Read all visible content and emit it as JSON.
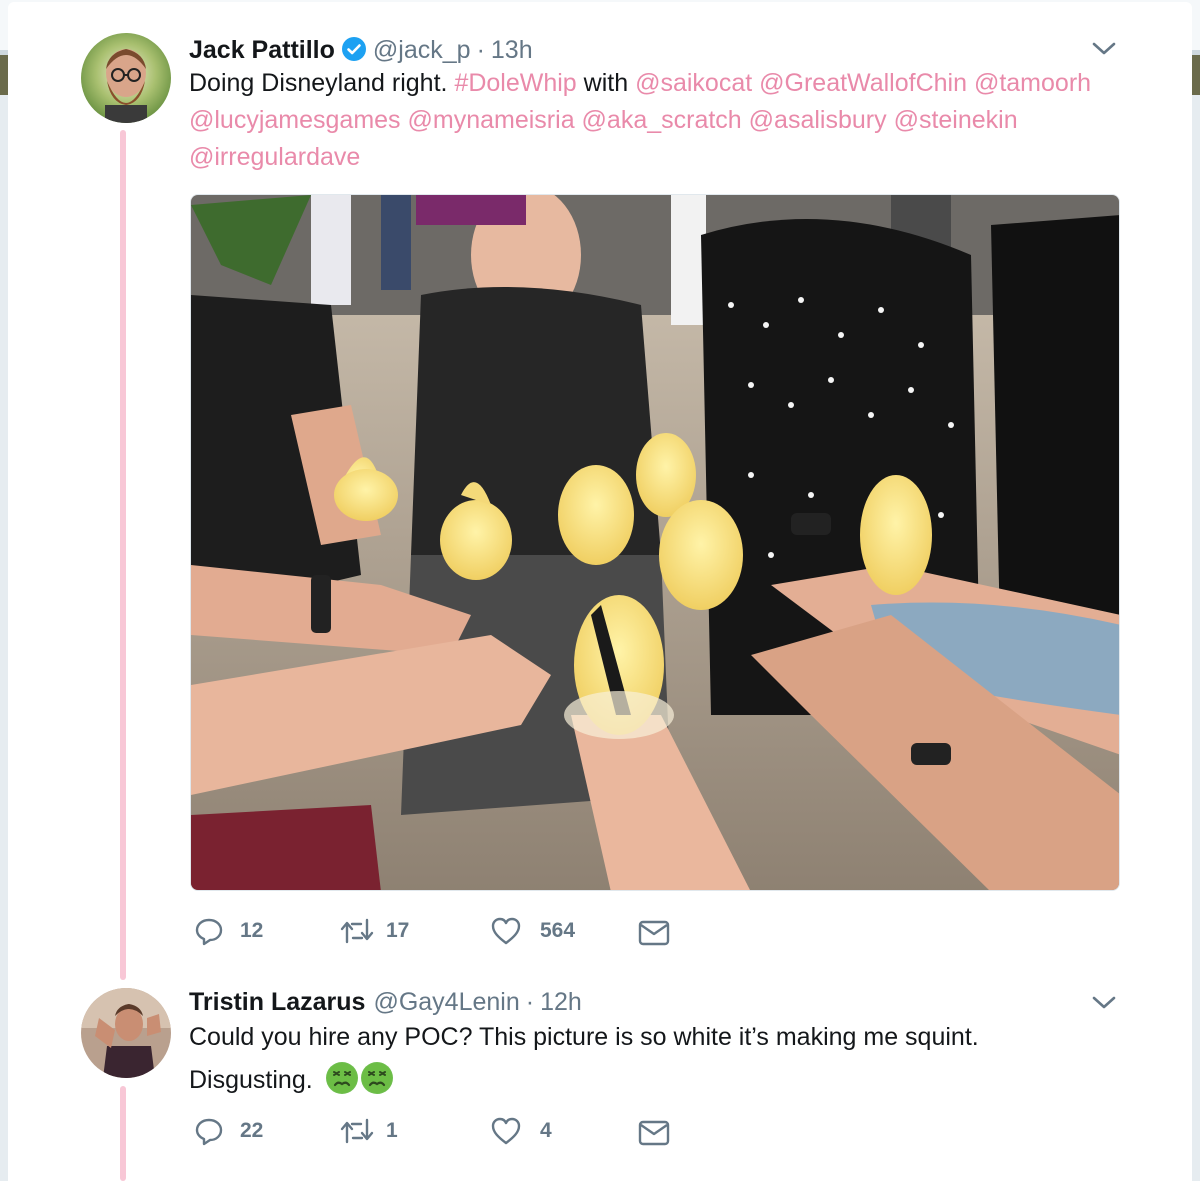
{
  "tweets": [
    {
      "name": "Jack Pattillo",
      "verified": true,
      "handle": "@jack_p",
      "separator": "·",
      "time": "13h",
      "text_plain": "Doing Disneyland right.",
      "hashtag": "#DoleWhip",
      "text_with": "with",
      "mentions": [
        "@saikocat",
        "@GreatWallofChin",
        "@tamoorh",
        "@lucyjamesgames",
        "@mynameisria",
        "@aka_scratch",
        "@asalisbury",
        "@steinekin",
        "@irregulardave"
      ],
      "replies": "12",
      "retweets": "17",
      "likes": "564"
    },
    {
      "name": "Tristin Lazarus",
      "verified": false,
      "handle": "@Gay4Lenin",
      "separator": "·",
      "time": "12h",
      "text_line1": "Could you hire any POC? This picture is so white it’s making me squint.",
      "text_line2": "Disgusting.",
      "emojis": [
        "nauseated-face-emoji",
        "nauseated-face-emoji"
      ],
      "replies": "22",
      "retweets": "1",
      "likes": "4"
    }
  ],
  "colors": {
    "link": "#e98aaa",
    "thread_line": "#f8c7d6",
    "muted": "#657786",
    "verified": "#1da1f2"
  }
}
